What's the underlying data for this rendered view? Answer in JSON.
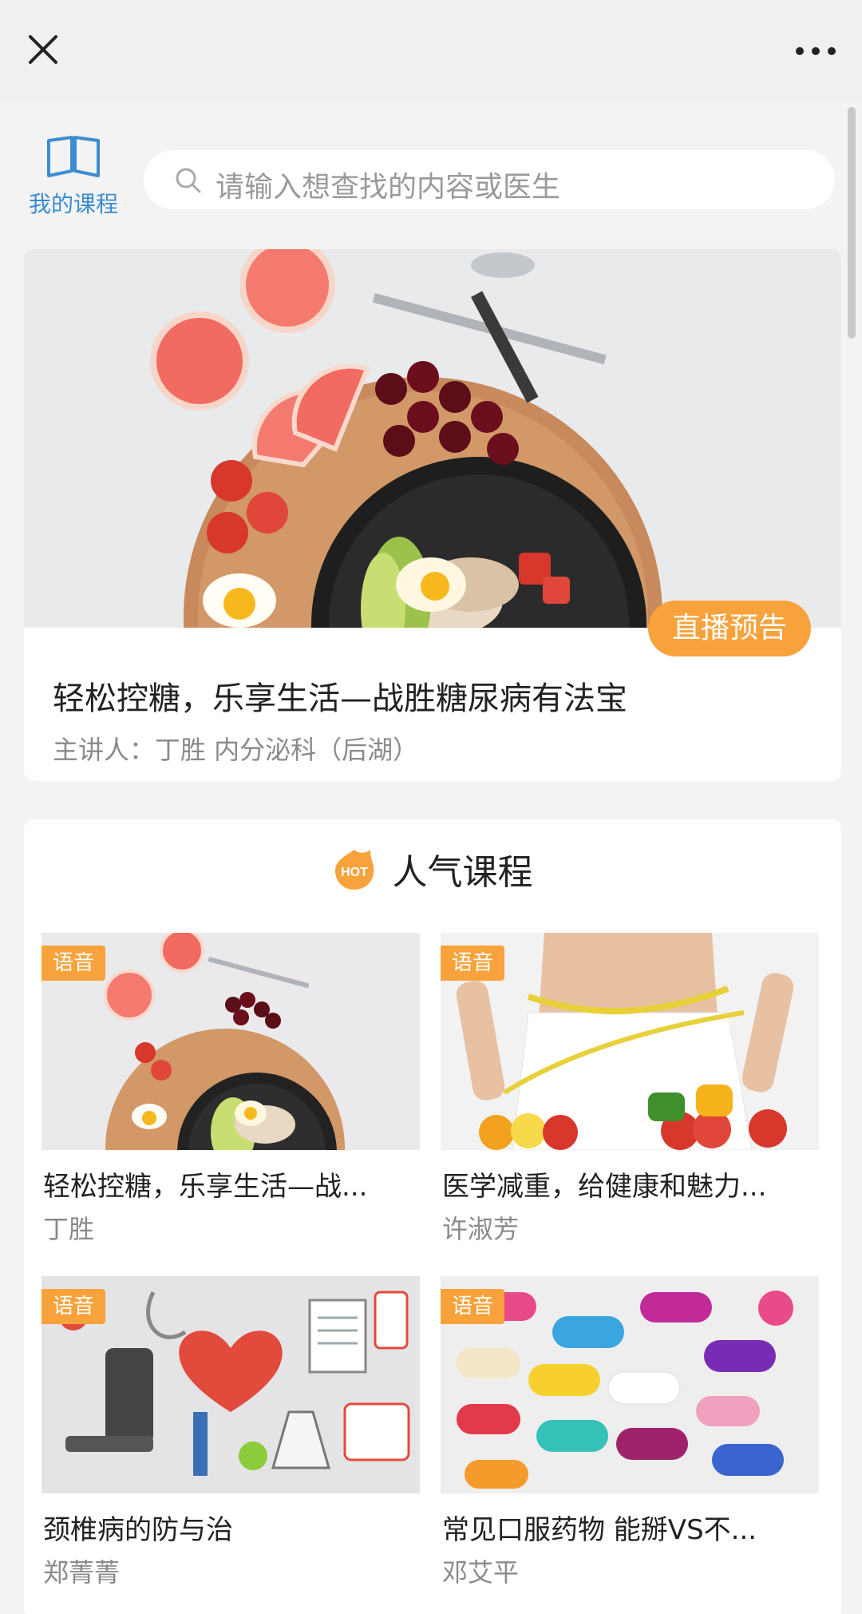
{
  "topbar": {
    "close_icon": "close-icon",
    "more_icon": "more-dots-icon"
  },
  "my_course": {
    "label": "我的课程",
    "icon": "book-icon"
  },
  "search": {
    "placeholder": "请输入想查找的内容或医生",
    "icon": "search-icon"
  },
  "banner": {
    "badge": "直播预告",
    "title": "轻松控糖，乐享生活—战胜糖尿病有法宝",
    "speaker": "主讲人：丁胜  内分泌科（后湖）"
  },
  "popular": {
    "hot_badge": "HOT",
    "title": "人气课程",
    "courses": [
      {
        "tag": "语音",
        "title": "轻松控糖，乐享生活—战...",
        "author": "丁胜"
      },
      {
        "tag": "语音",
        "title": "医学减重，给健康和魅力...",
        "author": "许淑芳"
      },
      {
        "tag": "语音",
        "title": "颈椎病的防与治",
        "author": "郑菁菁"
      },
      {
        "tag": "语音",
        "title": "常见口服药物  能掰VS不...",
        "author": "邓艾平"
      }
    ]
  },
  "colors": {
    "accent": "#f7a23b",
    "link_blue": "#3b8dd0"
  }
}
